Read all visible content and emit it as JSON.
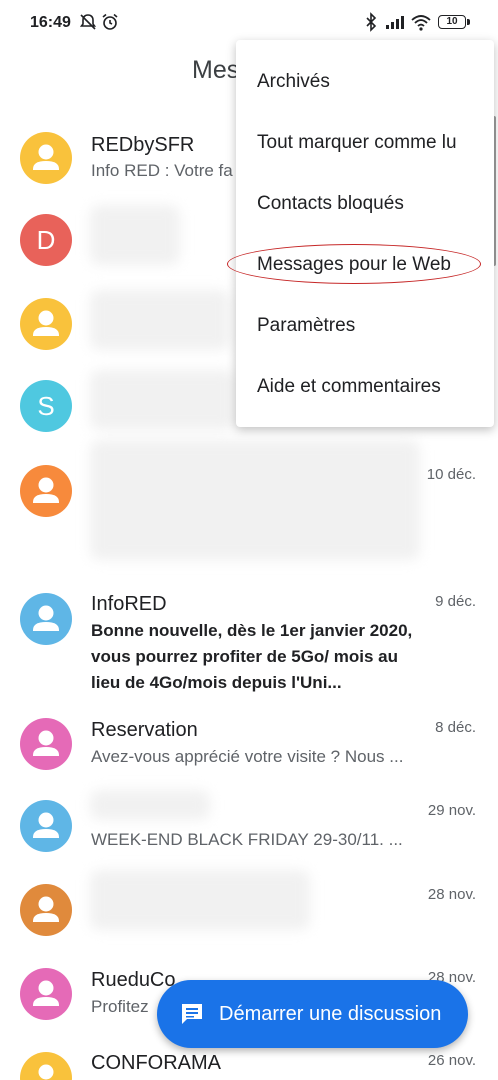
{
  "status_bar": {
    "time": "16:49",
    "battery": "10"
  },
  "header": {
    "title": "Mes"
  },
  "menu": {
    "items": [
      "Archivés",
      "Tout marquer comme lu",
      "Contacts bloqués",
      "Messages pour le Web",
      "Paramètres",
      "Aide et commentaires"
    ]
  },
  "conversations": [
    {
      "name": "REDbySFR",
      "snippet": "Info RED : Votre fa",
      "date": "",
      "avatar": "person",
      "color": "#f9c23c"
    },
    {
      "name": "",
      "snippet": "",
      "date": "",
      "avatar_letter": "D",
      "color": "#e8625a"
    },
    {
      "name": "",
      "snippet": "",
      "date": "",
      "avatar": "person",
      "color": "#f9c23c"
    },
    {
      "name": "",
      "snippet": "",
      "date": "",
      "avatar_letter": "S",
      "color": "#4fc8e0"
    },
    {
      "name": "",
      "snippet": "",
      "date": "10 déc.",
      "avatar": "person",
      "color": "#f78a3c"
    },
    {
      "name": "InfoRED",
      "snippet": "Bonne nouvelle, dès le 1er janvier 2020, vous pourrez profiter de 5Go/ mois au lieu de 4Go/mois depuis l'Uni...",
      "date": "9 déc.",
      "avatar": "person",
      "color": "#5fb6e6",
      "unread": true
    },
    {
      "name": "Reservation",
      "snippet": "Avez-vous apprécié votre visite ? Nous ...",
      "date": "8 déc.",
      "avatar": "person",
      "color": "#e56ab7"
    },
    {
      "name": "",
      "snippet": "WEEK-END BLACK FRIDAY 29-30/11. ...",
      "date": "29 nov.",
      "avatar": "person",
      "color": "#5fb6e6"
    },
    {
      "name": "",
      "snippet": "",
      "date": "28 nov.",
      "avatar": "person",
      "color": "#e08a3c"
    },
    {
      "name": "RueduCo",
      "snippet": "Profitez",
      "date": "28 nov.",
      "avatar": "person",
      "color": "#e56ab7"
    },
    {
      "name": "CONFORAMA",
      "snippet": "",
      "date": "26 nov.",
      "avatar": "person",
      "color": "#f9c23c"
    }
  ],
  "fab": {
    "label": "Démarrer une discussion"
  },
  "colors": {
    "accent": "#1a73e8",
    "annotation": "#c62828"
  }
}
